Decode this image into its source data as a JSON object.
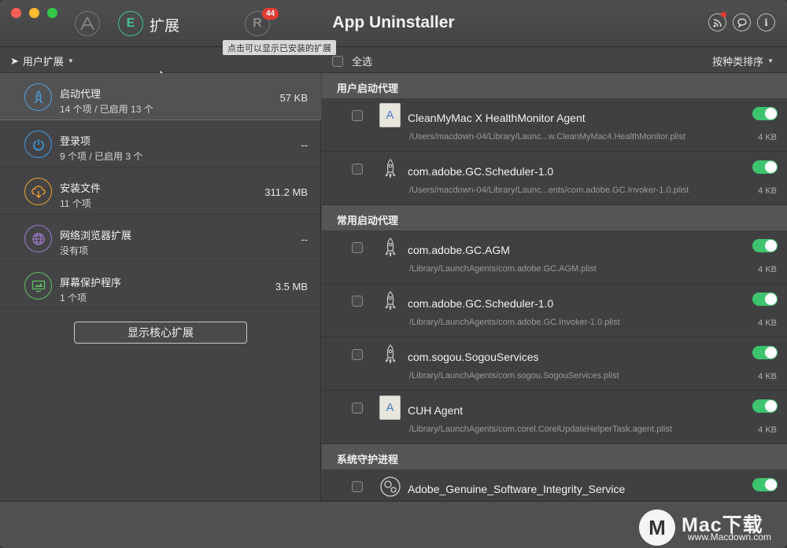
{
  "titlebar": {
    "app_title": "App Uninstaller",
    "ext_tab_label": "扩展",
    "ext_tab_glyph": "E",
    "remaining_glyph": "R",
    "badge_count": "44",
    "tooltip": "点击可以显示已安装的扩展",
    "info_glyph": "i"
  },
  "toolbar": {
    "user_ext_label": "用户扩展",
    "select_all_label": "全选",
    "sort_label": "按种类排序"
  },
  "categories": [
    {
      "name": "启动代理",
      "sub": "14 个项 / 已启用 13 个",
      "size": "57 KB",
      "icon": "rocket-icon",
      "color": "#4fa3e0"
    },
    {
      "name": "登录项",
      "sub": "9 个项 / 已启用 3 个",
      "size": "--",
      "icon": "power-icon",
      "color": "#3d9be0"
    },
    {
      "name": "安装文件",
      "sub": "11 个项",
      "size": "311.2 MB",
      "icon": "download-cloud-icon",
      "color": "#f0a030"
    },
    {
      "name": "网络浏览器扩展",
      "sub": "没有项",
      "size": "--",
      "icon": "globe-icon",
      "color": "#a07ad0"
    },
    {
      "name": "屏幕保护程序",
      "sub": "1 个项",
      "size": "3.5 MB",
      "icon": "screensaver-icon",
      "color": "#5ec060"
    }
  ],
  "core_button_label": "显示核心扩展",
  "sections": [
    {
      "title": "用户启动代理"
    },
    {
      "title": "常用启动代理"
    },
    {
      "title": "系统守护进程"
    }
  ],
  "rows": [
    {
      "name": "CleanMyMac X HealthMonitor Agent",
      "path": "/Users/macdown-04/Library/Launc...w.CleanMyMac4.HealthMonitor.plist",
      "size": "4 KB",
      "icon": "document-icon"
    },
    {
      "name": "com.adobe.GC.Scheduler-1.0",
      "path": "/Users/macdown-04/Library/Launc...ents/com.adobe.GC.Invoker-1.0.plist",
      "size": "4 KB",
      "icon": "rocket-icon"
    },
    {
      "name": "com.adobe.GC.AGM",
      "path": "/Library/LaunchAgents/com.adobe.GC.AGM.plist",
      "size": "4 KB",
      "icon": "rocket-icon"
    },
    {
      "name": "com.adobe.GC.Scheduler-1.0",
      "path": "/Library/LaunchAgents/com.adobe.GC.Invoker-1.0.plist",
      "size": "4 KB",
      "icon": "rocket-icon"
    },
    {
      "name": "com.sogou.SogouServices",
      "path": "/Library/LaunchAgents/com.sogou.SogouServices.plist",
      "size": "4 KB",
      "icon": "rocket-icon"
    },
    {
      "name": "CUH Agent",
      "path": "/Library/LaunchAgents/com.corel.CorelUpdateHelperTask.agent.plist",
      "size": "4 KB",
      "icon": "document-icon"
    },
    {
      "name": "Adobe_Genuine_Software_Integrity_Service",
      "path": "",
      "size": "",
      "icon": "gears-icon"
    }
  ],
  "watermark": {
    "logo_glyph": "M",
    "text": "Mac下载",
    "url": "www.Macdown.com"
  }
}
